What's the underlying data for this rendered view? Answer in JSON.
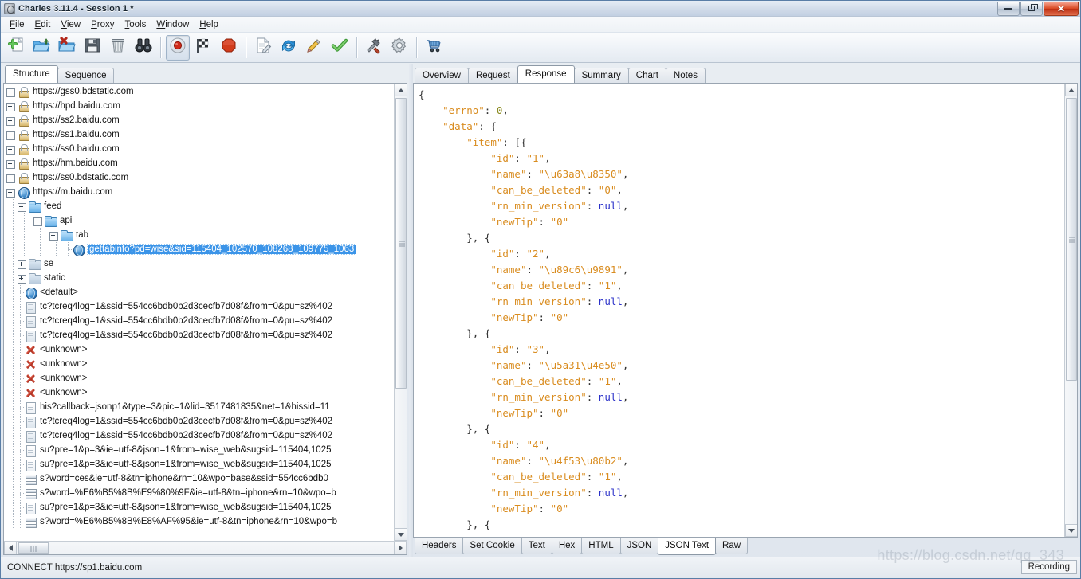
{
  "window": {
    "title": "Charles 3.11.4 - Session 1 *",
    "icon": "charles-app-icon",
    "minimize_label": "Minimize",
    "restore_label": "Restore",
    "close_label": "Close"
  },
  "menubar": {
    "items": [
      {
        "label": "File",
        "accel": "F"
      },
      {
        "label": "Edit",
        "accel": "E"
      },
      {
        "label": "View",
        "accel": "V"
      },
      {
        "label": "Proxy",
        "accel": "P"
      },
      {
        "label": "Tools",
        "accel": "T"
      },
      {
        "label": "Window",
        "accel": "W"
      },
      {
        "label": "Help",
        "accel": "H"
      }
    ]
  },
  "toolbar": {
    "buttons": [
      {
        "icon": "new-session-icon",
        "label": "New Session",
        "pressed": false
      },
      {
        "icon": "open-folder-icon",
        "label": "Open",
        "pressed": false
      },
      {
        "icon": "close-session-icon",
        "label": "Close",
        "pressed": false
      },
      {
        "icon": "save-icon",
        "label": "Save Session",
        "pressed": false
      },
      {
        "icon": "trash-icon",
        "label": "Clear Session",
        "pressed": false
      },
      {
        "icon": "binoculars-icon",
        "label": "Find",
        "pressed": false
      },
      {
        "sep": true
      },
      {
        "icon": "record-icon",
        "label": "Start Recording",
        "pressed": true
      },
      {
        "icon": "checkered-flag-icon",
        "label": "Stop Throttle",
        "pressed": false
      },
      {
        "icon": "stop-octagon-icon",
        "label": "Breakpoints",
        "pressed": false
      },
      {
        "sep": true
      },
      {
        "icon": "compose-icon",
        "label": "Compose",
        "pressed": false
      },
      {
        "icon": "repeat-icon",
        "label": "Repeat",
        "pressed": false
      },
      {
        "icon": "edit-pencil-icon",
        "label": "Edit",
        "pressed": false
      },
      {
        "icon": "validate-check-icon",
        "label": "Validate",
        "pressed": false
      },
      {
        "sep": true
      },
      {
        "icon": "tools-icon",
        "label": "Tools",
        "pressed": false
      },
      {
        "icon": "gear-icon",
        "label": "Settings",
        "pressed": false
      },
      {
        "sep": true
      },
      {
        "icon": "cart-icon",
        "label": "Purchase",
        "pressed": false
      }
    ]
  },
  "left_pane": {
    "tabs": [
      {
        "label": "Structure",
        "active": true
      },
      {
        "label": "Sequence",
        "active": false
      }
    ],
    "tree": [
      {
        "label": "https://gss0.bdstatic.com",
        "icon": "lock-icon",
        "indent": 0,
        "expander": "plus"
      },
      {
        "label": "https://hpd.baidu.com",
        "icon": "lock-icon",
        "indent": 0,
        "expander": "plus"
      },
      {
        "label": "https://ss2.baidu.com",
        "icon": "lock-icon",
        "indent": 0,
        "expander": "plus"
      },
      {
        "label": "https://ss1.baidu.com",
        "icon": "lock-icon",
        "indent": 0,
        "expander": "plus"
      },
      {
        "label": "https://ss0.baidu.com",
        "icon": "lock-icon",
        "indent": 0,
        "expander": "plus"
      },
      {
        "label": "https://hm.baidu.com",
        "icon": "lock-icon",
        "indent": 0,
        "expander": "plus"
      },
      {
        "label": "https://ss0.bdstatic.com",
        "icon": "lock-icon",
        "indent": 0,
        "expander": "plus"
      },
      {
        "label": "https://m.baidu.com",
        "icon": "globe-icon",
        "indent": 0,
        "expander": "minus"
      },
      {
        "label": "feed",
        "icon": "folder-icon",
        "indent": 1,
        "expander": "minus"
      },
      {
        "label": "api",
        "icon": "folder-icon",
        "indent": 2,
        "expander": "minus"
      },
      {
        "label": "tab",
        "icon": "folder-icon",
        "indent": 3,
        "expander": "minus"
      },
      {
        "label": "gettabinfo?pd=wise&sid=115404_102570_108268_109775_1063",
        "icon": "globe-icon",
        "indent": 4,
        "expander": "none",
        "selected": true
      },
      {
        "label": "se",
        "icon": "folder-grey-icon",
        "indent": 1,
        "expander": "plus"
      },
      {
        "label": "static",
        "icon": "folder-grey-icon",
        "indent": 1,
        "expander": "plus"
      },
      {
        "label": "<default>",
        "icon": "globe-icon",
        "indent": 1,
        "expander": "none"
      },
      {
        "label": "tc?tcreq4log=1&ssid=554cc6bdb0b2d3cecfb7d08f&from=0&pu=sz%402",
        "icon": "doc-shade-icon",
        "indent": 1,
        "expander": "none"
      },
      {
        "label": "tc?tcreq4log=1&ssid=554cc6bdb0b2d3cecfb7d08f&from=0&pu=sz%402",
        "icon": "doc-shade-icon",
        "indent": 1,
        "expander": "none"
      },
      {
        "label": "tc?tcreq4log=1&ssid=554cc6bdb0b2d3cecfb7d08f&from=0&pu=sz%402",
        "icon": "doc-shade-icon",
        "indent": 1,
        "expander": "none"
      },
      {
        "label": "<unknown>",
        "icon": "error-x-icon",
        "indent": 1,
        "expander": "none"
      },
      {
        "label": "<unknown>",
        "icon": "error-x-icon",
        "indent": 1,
        "expander": "none"
      },
      {
        "label": "<unknown>",
        "icon": "error-x-icon",
        "indent": 1,
        "expander": "none"
      },
      {
        "label": "<unknown>",
        "icon": "error-x-icon",
        "indent": 1,
        "expander": "none"
      },
      {
        "label": "his?callback=jsonp1&type=3&pic=1&lid=3517481835&net=1&hissid=11",
        "icon": "doc-icon",
        "indent": 1,
        "expander": "none"
      },
      {
        "label": "tc?tcreq4log=1&ssid=554cc6bdb0b2d3cecfb7d08f&from=0&pu=sz%402",
        "icon": "doc-shade-icon",
        "indent": 1,
        "expander": "none"
      },
      {
        "label": "tc?tcreq4log=1&ssid=554cc6bdb0b2d3cecfb7d08f&from=0&pu=sz%402",
        "icon": "doc-shade-icon",
        "indent": 1,
        "expander": "none"
      },
      {
        "label": "su?pre=1&p=3&ie=utf-8&json=1&from=wise_web&sugsid=115404,1025",
        "icon": "doc-icon",
        "indent": 1,
        "expander": "none"
      },
      {
        "label": "su?pre=1&p=3&ie=utf-8&json=1&from=wise_web&sugsid=115404,1025",
        "icon": "doc-icon",
        "indent": 1,
        "expander": "none"
      },
      {
        "label": "s?word=ces&ie=utf-8&tn=iphone&rn=10&wpo=base&ssid=554cc6bdb0",
        "icon": "stack-icon",
        "indent": 1,
        "expander": "none"
      },
      {
        "label": "s?word=%E6%B5%8B%E9%80%9F&ie=utf-8&tn=iphone&rn=10&wpo=b",
        "icon": "stack-icon",
        "indent": 1,
        "expander": "none"
      },
      {
        "label": "su?pre=1&p=3&ie=utf-8&json=1&from=wise_web&sugsid=115404,1025",
        "icon": "doc-icon",
        "indent": 1,
        "expander": "none"
      },
      {
        "label": "s?word=%E6%B5%8B%E8%AF%95&ie=utf-8&tn=iphone&rn=10&wpo=b",
        "icon": "stack-icon",
        "indent": 1,
        "expander": "none"
      }
    ]
  },
  "right_pane": {
    "tabs": [
      {
        "label": "Overview",
        "active": false
      },
      {
        "label": "Request",
        "active": false
      },
      {
        "label": "Response",
        "active": true
      },
      {
        "label": "Summary",
        "active": false
      },
      {
        "label": "Chart",
        "active": false
      },
      {
        "label": "Notes",
        "active": false
      }
    ],
    "bottom_tabs": [
      {
        "label": "Headers",
        "active": false
      },
      {
        "label": "Set Cookie",
        "active": false
      },
      {
        "label": "Text",
        "active": false
      },
      {
        "label": "Hex",
        "active": false
      },
      {
        "label": "HTML",
        "active": false
      },
      {
        "label": "JSON",
        "active": false
      },
      {
        "label": "JSON Text",
        "active": true
      },
      {
        "label": "Raw",
        "active": false
      }
    ],
    "json_lines": [
      [
        {
          "t": "p",
          "v": "{"
        }
      ],
      [
        {
          "t": "p",
          "v": "    "
        },
        {
          "t": "k",
          "v": "\"errno\""
        },
        {
          "t": "p",
          "v": ": "
        },
        {
          "t": "n",
          "v": "0"
        },
        {
          "t": "p",
          "v": ","
        }
      ],
      [
        {
          "t": "p",
          "v": "    "
        },
        {
          "t": "k",
          "v": "\"data\""
        },
        {
          "t": "p",
          "v": ": {"
        }
      ],
      [
        {
          "t": "p",
          "v": "        "
        },
        {
          "t": "k",
          "v": "\"item\""
        },
        {
          "t": "p",
          "v": ": [{"
        }
      ],
      [
        {
          "t": "p",
          "v": "            "
        },
        {
          "t": "k",
          "v": "\"id\""
        },
        {
          "t": "p",
          "v": ": "
        },
        {
          "t": "s",
          "v": "\"1\""
        },
        {
          "t": "p",
          "v": ","
        }
      ],
      [
        {
          "t": "p",
          "v": "            "
        },
        {
          "t": "k",
          "v": "\"name\""
        },
        {
          "t": "p",
          "v": ": "
        },
        {
          "t": "s",
          "v": "\"\\u63a8\\u8350\""
        },
        {
          "t": "p",
          "v": ","
        }
      ],
      [
        {
          "t": "p",
          "v": "            "
        },
        {
          "t": "k",
          "v": "\"can_be_deleted\""
        },
        {
          "t": "p",
          "v": ": "
        },
        {
          "t": "s",
          "v": "\"0\""
        },
        {
          "t": "p",
          "v": ","
        }
      ],
      [
        {
          "t": "p",
          "v": "            "
        },
        {
          "t": "k",
          "v": "\"rn_min_version\""
        },
        {
          "t": "p",
          "v": ": "
        },
        {
          "t": "nul",
          "v": "null"
        },
        {
          "t": "p",
          "v": ","
        }
      ],
      [
        {
          "t": "p",
          "v": "            "
        },
        {
          "t": "k",
          "v": "\"newTip\""
        },
        {
          "t": "p",
          "v": ": "
        },
        {
          "t": "s",
          "v": "\"0\""
        }
      ],
      [
        {
          "t": "p",
          "v": "        }, {"
        }
      ],
      [
        {
          "t": "p",
          "v": "            "
        },
        {
          "t": "k",
          "v": "\"id\""
        },
        {
          "t": "p",
          "v": ": "
        },
        {
          "t": "s",
          "v": "\"2\""
        },
        {
          "t": "p",
          "v": ","
        }
      ],
      [
        {
          "t": "p",
          "v": "            "
        },
        {
          "t": "k",
          "v": "\"name\""
        },
        {
          "t": "p",
          "v": ": "
        },
        {
          "t": "s",
          "v": "\"\\u89c6\\u9891\""
        },
        {
          "t": "p",
          "v": ","
        }
      ],
      [
        {
          "t": "p",
          "v": "            "
        },
        {
          "t": "k",
          "v": "\"can_be_deleted\""
        },
        {
          "t": "p",
          "v": ": "
        },
        {
          "t": "s",
          "v": "\"1\""
        },
        {
          "t": "p",
          "v": ","
        }
      ],
      [
        {
          "t": "p",
          "v": "            "
        },
        {
          "t": "k",
          "v": "\"rn_min_version\""
        },
        {
          "t": "p",
          "v": ": "
        },
        {
          "t": "nul",
          "v": "null"
        },
        {
          "t": "p",
          "v": ","
        }
      ],
      [
        {
          "t": "p",
          "v": "            "
        },
        {
          "t": "k",
          "v": "\"newTip\""
        },
        {
          "t": "p",
          "v": ": "
        },
        {
          "t": "s",
          "v": "\"0\""
        }
      ],
      [
        {
          "t": "p",
          "v": "        }, {"
        }
      ],
      [
        {
          "t": "p",
          "v": "            "
        },
        {
          "t": "k",
          "v": "\"id\""
        },
        {
          "t": "p",
          "v": ": "
        },
        {
          "t": "s",
          "v": "\"3\""
        },
        {
          "t": "p",
          "v": ","
        }
      ],
      [
        {
          "t": "p",
          "v": "            "
        },
        {
          "t": "k",
          "v": "\"name\""
        },
        {
          "t": "p",
          "v": ": "
        },
        {
          "t": "s",
          "v": "\"\\u5a31\\u4e50\""
        },
        {
          "t": "p",
          "v": ","
        }
      ],
      [
        {
          "t": "p",
          "v": "            "
        },
        {
          "t": "k",
          "v": "\"can_be_deleted\""
        },
        {
          "t": "p",
          "v": ": "
        },
        {
          "t": "s",
          "v": "\"1\""
        },
        {
          "t": "p",
          "v": ","
        }
      ],
      [
        {
          "t": "p",
          "v": "            "
        },
        {
          "t": "k",
          "v": "\"rn_min_version\""
        },
        {
          "t": "p",
          "v": ": "
        },
        {
          "t": "nul",
          "v": "null"
        },
        {
          "t": "p",
          "v": ","
        }
      ],
      [
        {
          "t": "p",
          "v": "            "
        },
        {
          "t": "k",
          "v": "\"newTip\""
        },
        {
          "t": "p",
          "v": ": "
        },
        {
          "t": "s",
          "v": "\"0\""
        }
      ],
      [
        {
          "t": "p",
          "v": "        }, {"
        }
      ],
      [
        {
          "t": "p",
          "v": "            "
        },
        {
          "t": "k",
          "v": "\"id\""
        },
        {
          "t": "p",
          "v": ": "
        },
        {
          "t": "s",
          "v": "\"4\""
        },
        {
          "t": "p",
          "v": ","
        }
      ],
      [
        {
          "t": "p",
          "v": "            "
        },
        {
          "t": "k",
          "v": "\"name\""
        },
        {
          "t": "p",
          "v": ": "
        },
        {
          "t": "s",
          "v": "\"\\u4f53\\u80b2\""
        },
        {
          "t": "p",
          "v": ","
        }
      ],
      [
        {
          "t": "p",
          "v": "            "
        },
        {
          "t": "k",
          "v": "\"can_be_deleted\""
        },
        {
          "t": "p",
          "v": ": "
        },
        {
          "t": "s",
          "v": "\"1\""
        },
        {
          "t": "p",
          "v": ","
        }
      ],
      [
        {
          "t": "p",
          "v": "            "
        },
        {
          "t": "k",
          "v": "\"rn_min_version\""
        },
        {
          "t": "p",
          "v": ": "
        },
        {
          "t": "nul",
          "v": "null"
        },
        {
          "t": "p",
          "v": ","
        }
      ],
      [
        {
          "t": "p",
          "v": "            "
        },
        {
          "t": "k",
          "v": "\"newTip\""
        },
        {
          "t": "p",
          "v": ": "
        },
        {
          "t": "s",
          "v": "\"0\""
        }
      ],
      [
        {
          "t": "p",
          "v": "        }, {"
        }
      ]
    ]
  },
  "statusbar": {
    "text": "CONNECT https://sp1.baidu.com",
    "recording_label": "Recording"
  },
  "watermark": {
    "text": "https://blog.csdn.net/qq_343"
  }
}
